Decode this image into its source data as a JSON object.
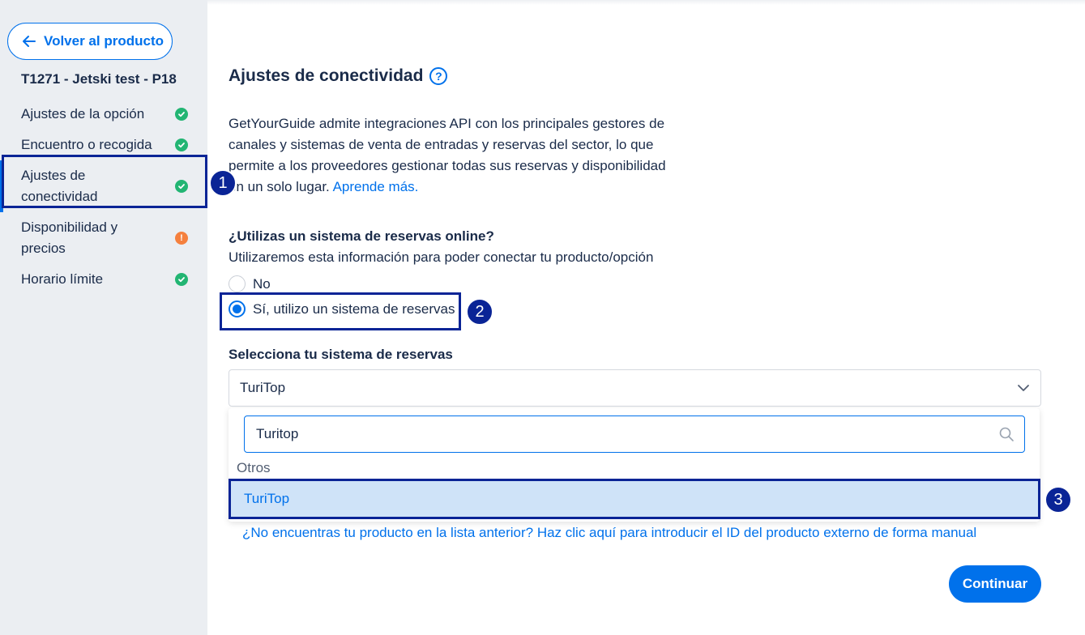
{
  "sidebar": {
    "back_label": "Volver al producto",
    "product_title": "T1271 - Jetski test - P18",
    "items": [
      {
        "label": "Ajustes de la opción",
        "status": "complete"
      },
      {
        "label": "Encuentro o recogida",
        "status": "complete"
      },
      {
        "label": "Ajustes de conectividad",
        "status": "complete"
      },
      {
        "label": "Disponibilidad y precios",
        "status": "warning"
      },
      {
        "label": "Horario límite",
        "status": "complete"
      }
    ]
  },
  "main": {
    "title": "Ajustes de conectividad",
    "help_icon": "?",
    "intro_text": "GetYourGuide admite integraciones API con los principales gestores de canales y sistemas de venta de entradas y reservas del sector, lo que permite a los proveedores gestionar todas sus reservas y disponibilidad en un solo lugar.",
    "intro_link": "Aprende más.",
    "question": "¿Utilizas un sistema de reservas online?",
    "question_sub": "Utilizaremos esta información para poder conectar tu producto/opción",
    "radio_options": [
      {
        "label": "No",
        "checked": false
      },
      {
        "label": "Sí, utilizo un sistema de reservas",
        "checked": true
      }
    ],
    "select_label": "Selecciona tu sistema de reservas",
    "select_value": "TuriTop",
    "search_value": "Turitop",
    "group_label": "Otros",
    "option_label": "TuriTop",
    "manual_link": "¿No encuentras tu producto en la lista anterior? Haz clic aquí para introducir el ID del producto externo de forma manual",
    "continue_label": "Continuar"
  },
  "annotations": {
    "step1": "1",
    "step2": "2",
    "step3": "3"
  },
  "colors": {
    "accent": "#0071eb",
    "success": "#22b573",
    "warning": "#f5803e",
    "annotation": "#0a2496",
    "sidebar_bg": "#ebeef2"
  }
}
